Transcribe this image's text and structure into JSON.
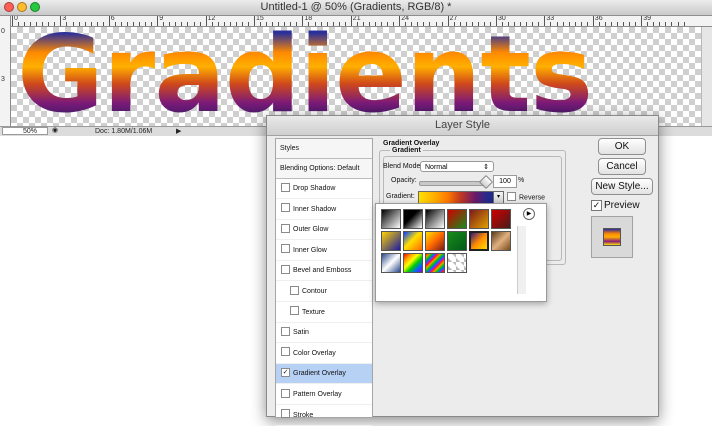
{
  "window": {
    "title": "Untitled-1 @ 50% (Gradients, RGB/8) *",
    "traffic_colors": [
      "#ff5f57",
      "#febc2e",
      "#28c840"
    ]
  },
  "rulers": {
    "h_labels": [
      "0",
      "3",
      "6",
      "9",
      "12",
      "15",
      "18",
      "21",
      "24",
      "27",
      "30",
      "33",
      "36",
      "39"
    ],
    "v_labels": [
      "0",
      "3"
    ]
  },
  "canvas": {
    "text": "Gradients"
  },
  "status": {
    "zoom": "50%",
    "doc_size": "Doc: 1.80M/1.06M"
  },
  "dialog": {
    "title": "Layer Style",
    "styles_panel": {
      "header": "Styles",
      "blending": "Blending Options: Default",
      "items": [
        {
          "label": "Drop Shadow",
          "checked": false
        },
        {
          "label": "Inner Shadow",
          "checked": false
        },
        {
          "label": "Outer Glow",
          "checked": false
        },
        {
          "label": "Inner Glow",
          "checked": false
        },
        {
          "label": "Bevel and Emboss",
          "checked": false
        },
        {
          "label": "Contour",
          "checked": false
        },
        {
          "label": "Texture",
          "checked": false
        },
        {
          "label": "Satin",
          "checked": false
        },
        {
          "label": "Color Overlay",
          "checked": false
        },
        {
          "label": "Gradient Overlay",
          "checked": true
        },
        {
          "label": "Pattern Overlay",
          "checked": false
        },
        {
          "label": "Stroke",
          "checked": false
        }
      ]
    },
    "gradient_overlay": {
      "title": "Gradient Overlay",
      "sub_title": "Gradient",
      "blend_mode_label": "Blend Mode:",
      "blend_mode_value": "Normal",
      "opacity_label": "Opacity:",
      "opacity_value": "100",
      "opacity_unit": "%",
      "gradient_label": "Gradient:",
      "reverse_label": "Reverse"
    },
    "buttons": {
      "ok": "OK",
      "cancel": "Cancel",
      "new_style": "New Style..."
    },
    "preview": {
      "label": "Preview",
      "checked": true
    }
  },
  "picker": {
    "swatches": [
      "linear-gradient(135deg,#000 0%,#fff 100%)",
      "linear-gradient(135deg,#000 0%,#000 40%,transparent 100%)",
      "linear-gradient(135deg,#000 0%,#777 45%,#fff 100%)",
      "linear-gradient(135deg,#d00000 0%,#1a8a1a 100%)",
      "linear-gradient(135deg,#7a1a1a 0%,#e0a000 100%)",
      "linear-gradient(135deg,#d00000 0%,#4a1a1a 100%)",
      "linear-gradient(135deg,#ffd200 0%,#1a1aa0 100%)",
      "linear-gradient(135deg,#0040ff 0%,#ffe000 45%,#ff6a00 100%)",
      "linear-gradient(135deg,#ffe000 0%,#ff6a00 50%,#7a1a1a 100%)",
      "linear-gradient(135deg,#1a8a1a 0%,#005a1a 100%)",
      "linear-gradient(135deg,#3a1a7a 0%,#ff8a00 50%,#ffe000 100%)",
      "linear-gradient(135deg,#5a3a1a 0%,#e0b080 50%,#7a4a1a 100%)",
      "linear-gradient(135deg,#2a4a8a 0%,#ffffff 50%,#2a4a8a 100%)",
      "linear-gradient(135deg,#ff0000 0%,#ff9900 20%,#ffff00 40%,#00cc00 60%,#0066ff 80%,#9900cc 100%)",
      "repeating-linear-gradient(135deg,#ff0000 0px,#ff9900 2px,#00cc00 4px,#0066ff 6px,#ff00cc 8px)",
      "linear-gradient(45deg,#bbb 25%,#fff 25%,#fff 75%,#bbb 75%)"
    ]
  }
}
